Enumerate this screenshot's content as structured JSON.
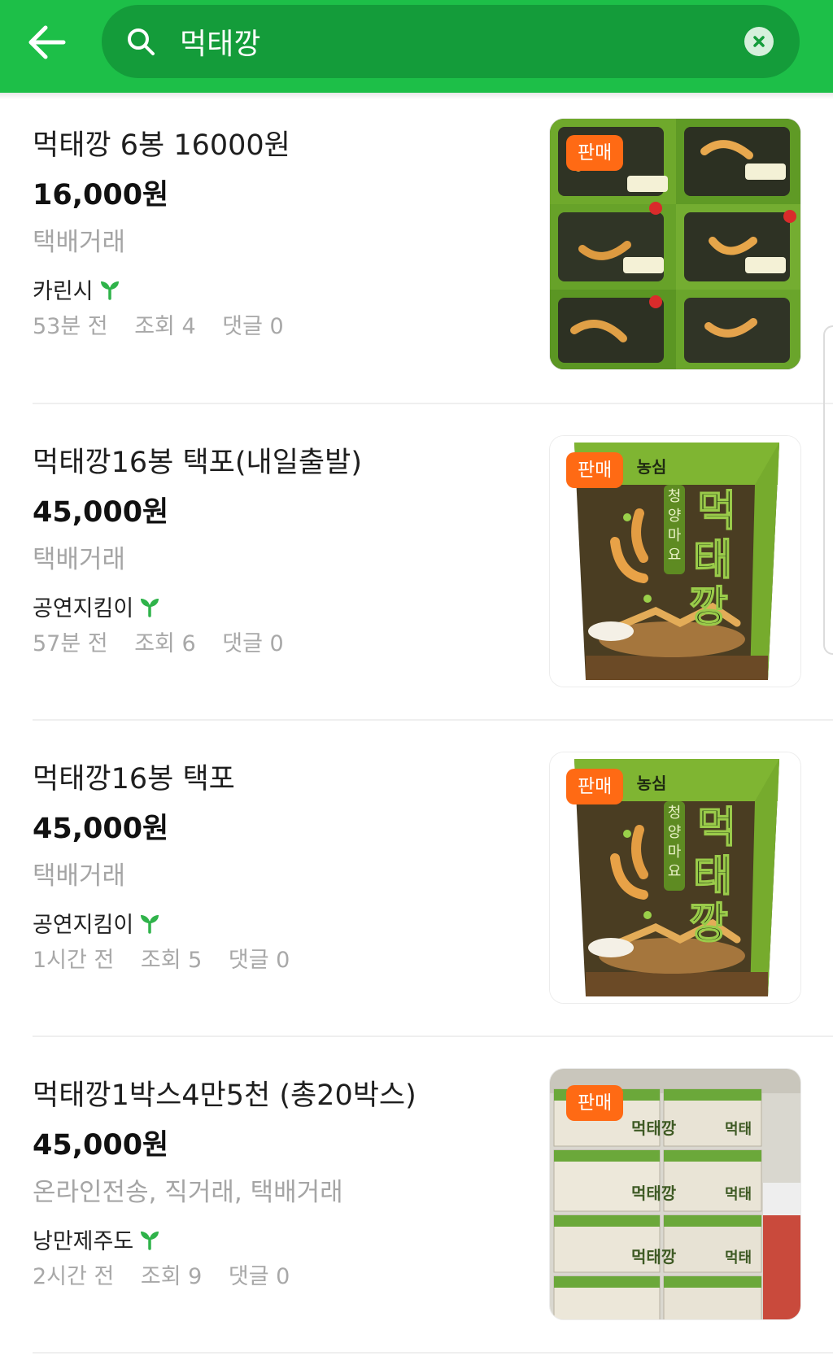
{
  "search": {
    "query": "먹태깡",
    "back_icon": "arrow-left-icon",
    "search_icon": "search-icon",
    "clear_icon": "close-circle-icon"
  },
  "colors": {
    "brand_green": "#1dbf48",
    "search_bg": "#149c3a",
    "badge_orange": "#ff6a14"
  },
  "items": [
    {
      "title": "먹태깡 6봉 16000원",
      "price": "16,000원",
      "trade": "택배거래",
      "seller": "카린시",
      "time": "53분 전",
      "views": "조회 4",
      "comments": "댓글 0",
      "badge": "판매",
      "image": "snack-bags-pile"
    },
    {
      "title": "먹태깡16봉 택포(내일출발)",
      "price": "45,000원",
      "trade": "택배거래",
      "seller": "공연지킴이",
      "time": "57분 전",
      "views": "조회 6",
      "comments": "댓글 0",
      "badge": "판매",
      "image": "snack-bag",
      "brand": "농심",
      "product": "먹태깡",
      "flavor": "청양마요"
    },
    {
      "title": "먹태깡16봉 택포",
      "price": "45,000원",
      "trade": "택배거래",
      "seller": "공연지킴이",
      "time": "1시간 전",
      "views": "조회 5",
      "comments": "댓글 0",
      "badge": "판매",
      "image": "snack-bag",
      "brand": "농심",
      "product": "먹태깡",
      "flavor": "청양마요"
    },
    {
      "title": "먹태깡1박스4만5천 (총20박스)",
      "price": "45,000원",
      "trade": "온라인전송, 직거래, 택배거래",
      "seller": "낭만제주도",
      "time": "2시간 전",
      "views": "조회 9",
      "comments": "댓글 0",
      "badge": "판매",
      "image": "stacked-boxes",
      "box_label": "먹태깡"
    }
  ]
}
